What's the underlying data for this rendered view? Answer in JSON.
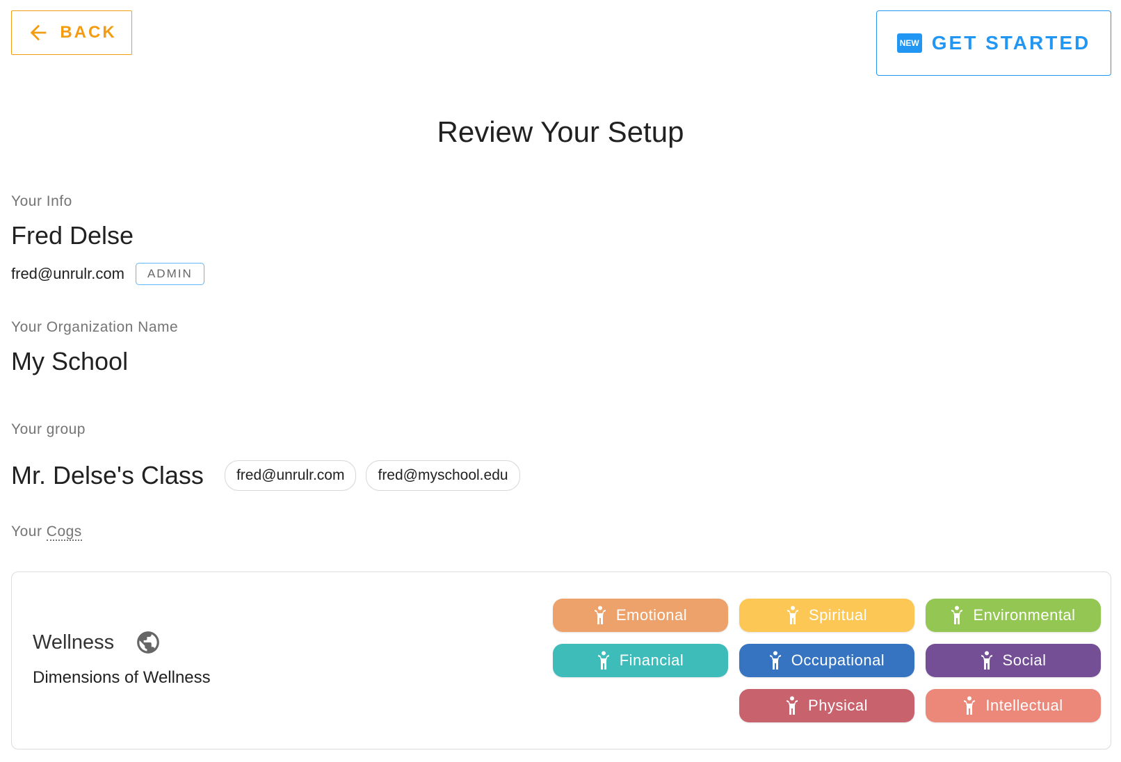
{
  "header": {
    "back_label": "BACK",
    "start_label": "GET STARTED",
    "new_badge": "NEW",
    "back_color": "#f39c12",
    "start_color": "#2196f3"
  },
  "title": "Review Your Setup",
  "info": {
    "label": "Your Info",
    "name": "Fred Delse",
    "email": "fred@unrulr.com",
    "role_badge": "ADMIN"
  },
  "organization": {
    "label": "Your Organization Name",
    "name": "My School"
  },
  "group": {
    "label": "Your group",
    "name": "Mr. Delse's Class",
    "members": [
      "fred@unrulr.com",
      "fred@myschool.edu"
    ]
  },
  "cogs": {
    "label_prefix": "Your",
    "label_abbr": "Cogs",
    "items": [
      {
        "name": "Wellness",
        "icon": "globe-icon",
        "description": "Dimensions of Wellness",
        "tags": [
          {
            "label": "Emotional",
            "color": "#eda26b"
          },
          {
            "label": "Spiritual",
            "color": "#fdc755"
          },
          {
            "label": "Environmental",
            "color": "#93c653"
          },
          {
            "label": "Financial",
            "color": "#3dbcb9"
          },
          {
            "label": "Occupational",
            "color": "#3674c2"
          },
          {
            "label": "Social",
            "color": "#744f96"
          },
          {
            "label": "Physical",
            "color": "#c8626d"
          },
          {
            "label": "Intellectual",
            "color": "#ec887a"
          }
        ]
      }
    ]
  }
}
